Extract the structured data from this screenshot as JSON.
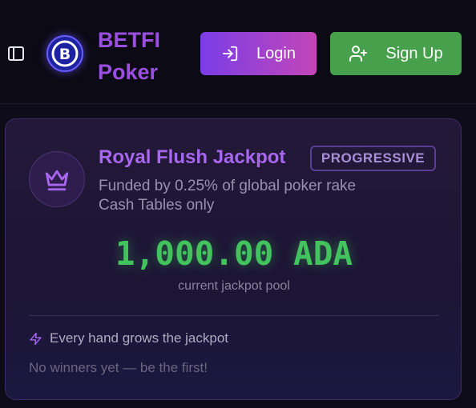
{
  "header": {
    "brand_line1": "BETFI",
    "brand_line2": "Poker",
    "login_label": "Login",
    "signup_label": "Sign Up"
  },
  "jackpot": {
    "title": "Royal Flush Jackpot",
    "badge": "PROGRESSIVE",
    "funded_text": "Funded by 0.25% of global poker rake",
    "tables_text": "Cash Tables only",
    "amount": "1,000.00 ADA",
    "amount_label": "current jackpot pool",
    "grow_text": "Every hand grows the jackpot",
    "winners_text": "No winners yet — be the first!"
  },
  "icons": {
    "sidebar": "sidebar-toggle-icon",
    "logo": "betfi-logo-icon",
    "login": "login-icon",
    "signup": "user-plus-icon",
    "crown": "crown-icon",
    "bolt": "lightning-icon"
  },
  "colors": {
    "brand": "#9b4fe0",
    "login_gradient_start": "#7a3de6",
    "login_gradient_end": "#c346b8",
    "signup": "#47a04b",
    "jackpot_amount": "#43c35d"
  }
}
